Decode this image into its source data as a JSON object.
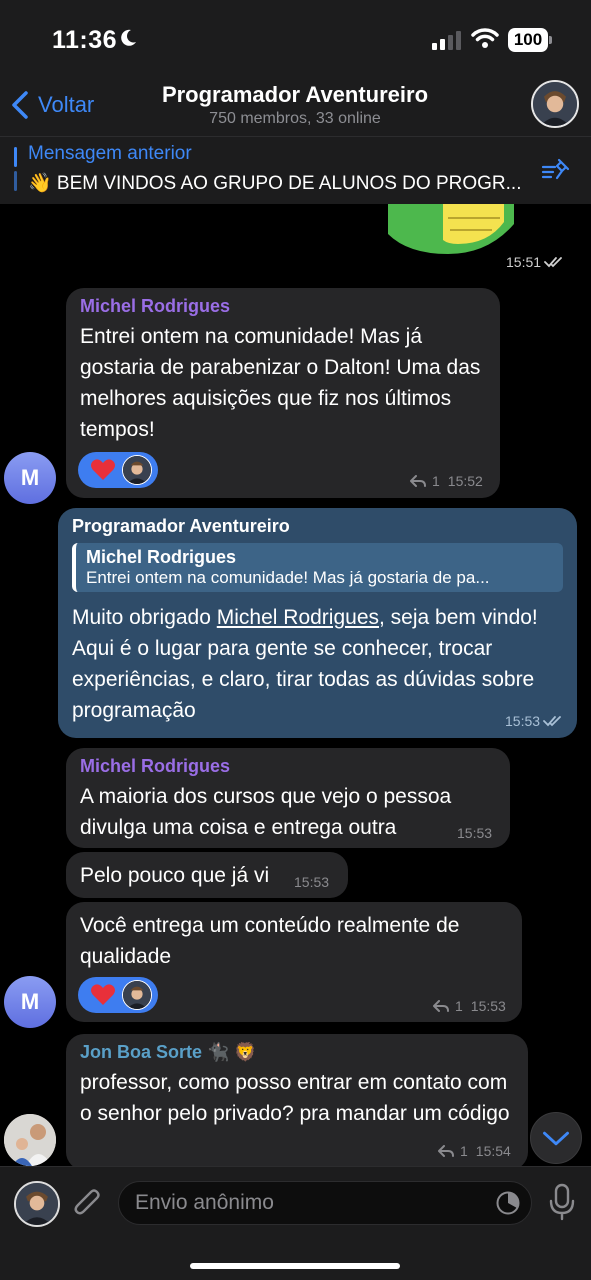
{
  "status_bar": {
    "time": "11:36",
    "battery": "100"
  },
  "header": {
    "back_label": "Voltar",
    "title": "Programador Aventureiro",
    "subtitle": "750 membros, 33 online"
  },
  "pinned": {
    "title": "Mensagem anterior",
    "text": "👋 BEM VINDOS AO GRUPO DE ALUNOS DO PROGR..."
  },
  "messages": {
    "sticker_time": "15:51",
    "m1": {
      "sender": "Michel Rodrigues",
      "text": "Entrei ontem na comunidade! Mas já gostaria de parabenizar o Dalton! Uma das melhores aquisições que fiz nos últimos tempos!",
      "reply_count": "1",
      "time": "15:52",
      "avatar_letter": "M"
    },
    "m2": {
      "sender": "Programador Aventureiro",
      "quote_name": "Michel Rodrigues",
      "quote_text": "Entrei ontem na comunidade! Mas já gostaria de pa...",
      "text_before": "Muito obrigado ",
      "mention": "Michel Rodrigues",
      "text_after": ", seja bem vindo! Aqui é o lugar para gente se conhecer, trocar experiências, e claro, tirar todas as dúvidas sobre programação",
      "time": "15:53"
    },
    "m3": {
      "sender": "Michel Rodrigues",
      "text": "A maioria dos cursos que vejo o pessoa divulga uma coisa e entrega outra",
      "time": "15:53"
    },
    "m4": {
      "text": "Pelo pouco que já vi",
      "time": "15:53"
    },
    "m5": {
      "text": "Você entrega um conteúdo realmente de qualidade",
      "reply_count": "1",
      "time": "15:53",
      "avatar_letter": "M"
    },
    "m6": {
      "sender": "Jon Boa Sorte 🐈‍⬛ 🦁",
      "text": "professor, como posso entrar em contato com o senhor pelo privado? pra mandar um código",
      "reply_count": "1",
      "time": "15:54"
    }
  },
  "input": {
    "placeholder": "Envio anônimo"
  },
  "colors": {
    "accent": "#3e88f7",
    "outgoing_bubble": "#2f4c69",
    "incoming_bubble": "#262628",
    "sender_michel": "#9a6ee6",
    "sender_jon": "#5aa0c8",
    "reaction_pill": "#3e7df0"
  }
}
